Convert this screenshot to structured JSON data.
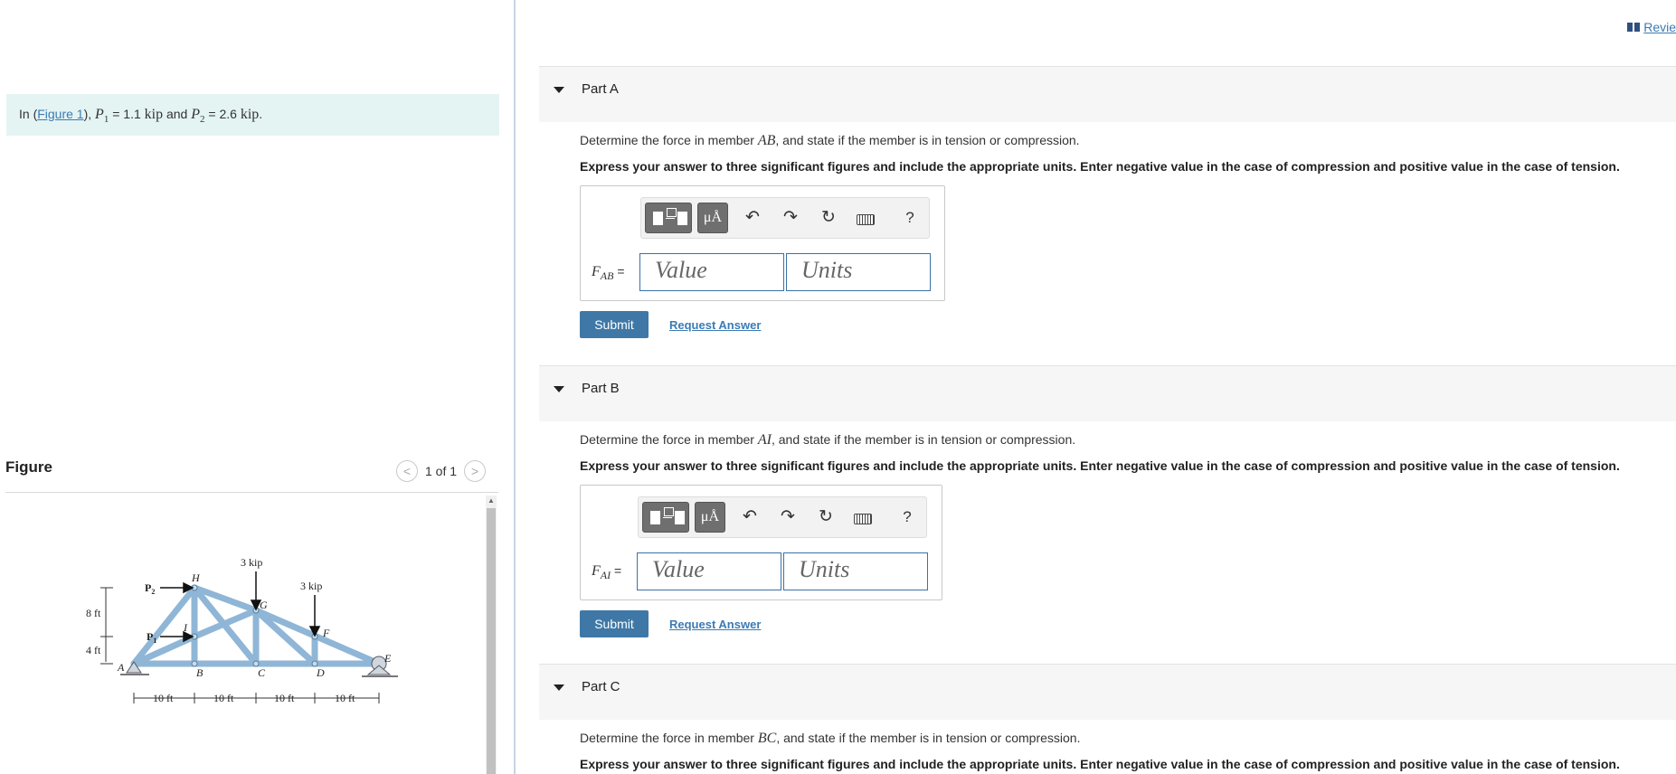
{
  "header": {
    "review_link": "Revie"
  },
  "intro": {
    "prefix": "In (",
    "figure_link": "Figure 1",
    "text_mid": "), ",
    "p1": "P",
    "p1_sub": "1",
    "p1_val": " = 1.1 ",
    "unit1": "kip",
    "and": " and ",
    "p2": "P",
    "p2_sub": "2",
    "p2_val": " = 2.6 ",
    "unit2": "kip",
    "end": "."
  },
  "figure": {
    "title": "Figure",
    "pager": "1 of 1",
    "labels": {
      "load_g": "3 kip",
      "load_f": "3 kip",
      "p2": "P",
      "p2_sub": "2",
      "p1": "P",
      "p1_sub": "1",
      "h": "H",
      "g": "G",
      "i": "I",
      "f": "F",
      "a": "A",
      "b": "B",
      "c": "C",
      "d": "D",
      "e": "E",
      "dim_8ft": "8 ft",
      "dim_4ft": "4 ft",
      "span1": "10 ft",
      "span2": "10 ft",
      "span3": "10 ft",
      "span4": "10 ft"
    }
  },
  "parts": [
    {
      "title": "Part A",
      "question_pre": "Determine the force in member ",
      "member": "AB",
      "question_post": ", and state if the member is in tension or compression.",
      "instruction": "Express your answer to three significant figures and include the appropriate units. Enter negative value in the case of compression and positive value in the case of tension.",
      "var": "F",
      "var_sub": "AB",
      "eq": " =",
      "value_placeholder": "Value",
      "units_placeholder": "Units",
      "submit": "Submit",
      "request": "Request Answer"
    },
    {
      "title": "Part B",
      "question_pre": "Determine the force in member ",
      "member": "AI",
      "question_post": ", and state if the member is in tension or compression.",
      "instruction": "Express your answer to three significant figures and include the appropriate units. Enter negative value in the case of compression and positive value in the case of tension.",
      "var": "F",
      "var_sub": "AI",
      "eq": " =",
      "value_placeholder": "Value",
      "units_placeholder": "Units",
      "submit": "Submit",
      "request": "Request Answer"
    },
    {
      "title": "Part C",
      "question_pre": "Determine the force in member ",
      "member": "BC",
      "question_post": ", and state if the member is in tension or compression.",
      "instruction": "Express your answer to three significant figures and include the appropriate units. Enter negative value in the case of compression and positive value in the case of tension."
    }
  ],
  "toolbar": {
    "units_label": "μÅ",
    "undo": "↶",
    "redo": "↷",
    "reset": "↻",
    "help": "?"
  },
  "colors": {
    "accent": "#3f78a6",
    "intro_bg": "#e4f4f3",
    "truss": "#a9cbe3"
  }
}
